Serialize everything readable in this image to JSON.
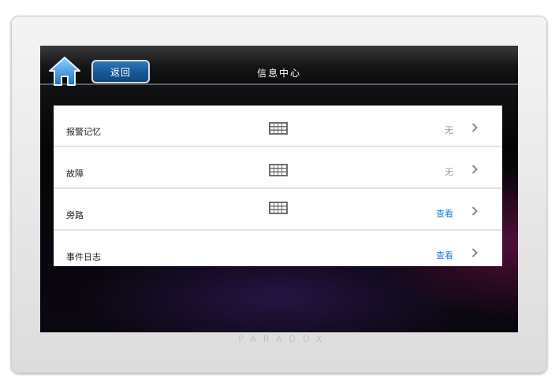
{
  "header": {
    "back_label": "返回",
    "title": "信息中心"
  },
  "list": {
    "items": [
      {
        "label": "报警记忆",
        "value": "无",
        "value_is_link": false,
        "has_keypad_icon": true
      },
      {
        "label": "故障",
        "value": "无",
        "value_is_link": false,
        "has_keypad_icon": true
      },
      {
        "label": "旁路",
        "value": "查看",
        "value_is_link": true,
        "has_keypad_icon": true
      },
      {
        "label": "事件日志",
        "value": "查看",
        "value_is_link": true,
        "has_keypad_icon": false
      }
    ]
  },
  "brand": {
    "text": "PARADOX"
  },
  "colors": {
    "accent_blue": "#1f7fd6",
    "button_blue": "#175a99",
    "muted_value": "#9a9a9a"
  },
  "icons": {
    "home": "home-icon",
    "keypad": "keypad-icon",
    "chevron": "chevron-right-icon"
  }
}
